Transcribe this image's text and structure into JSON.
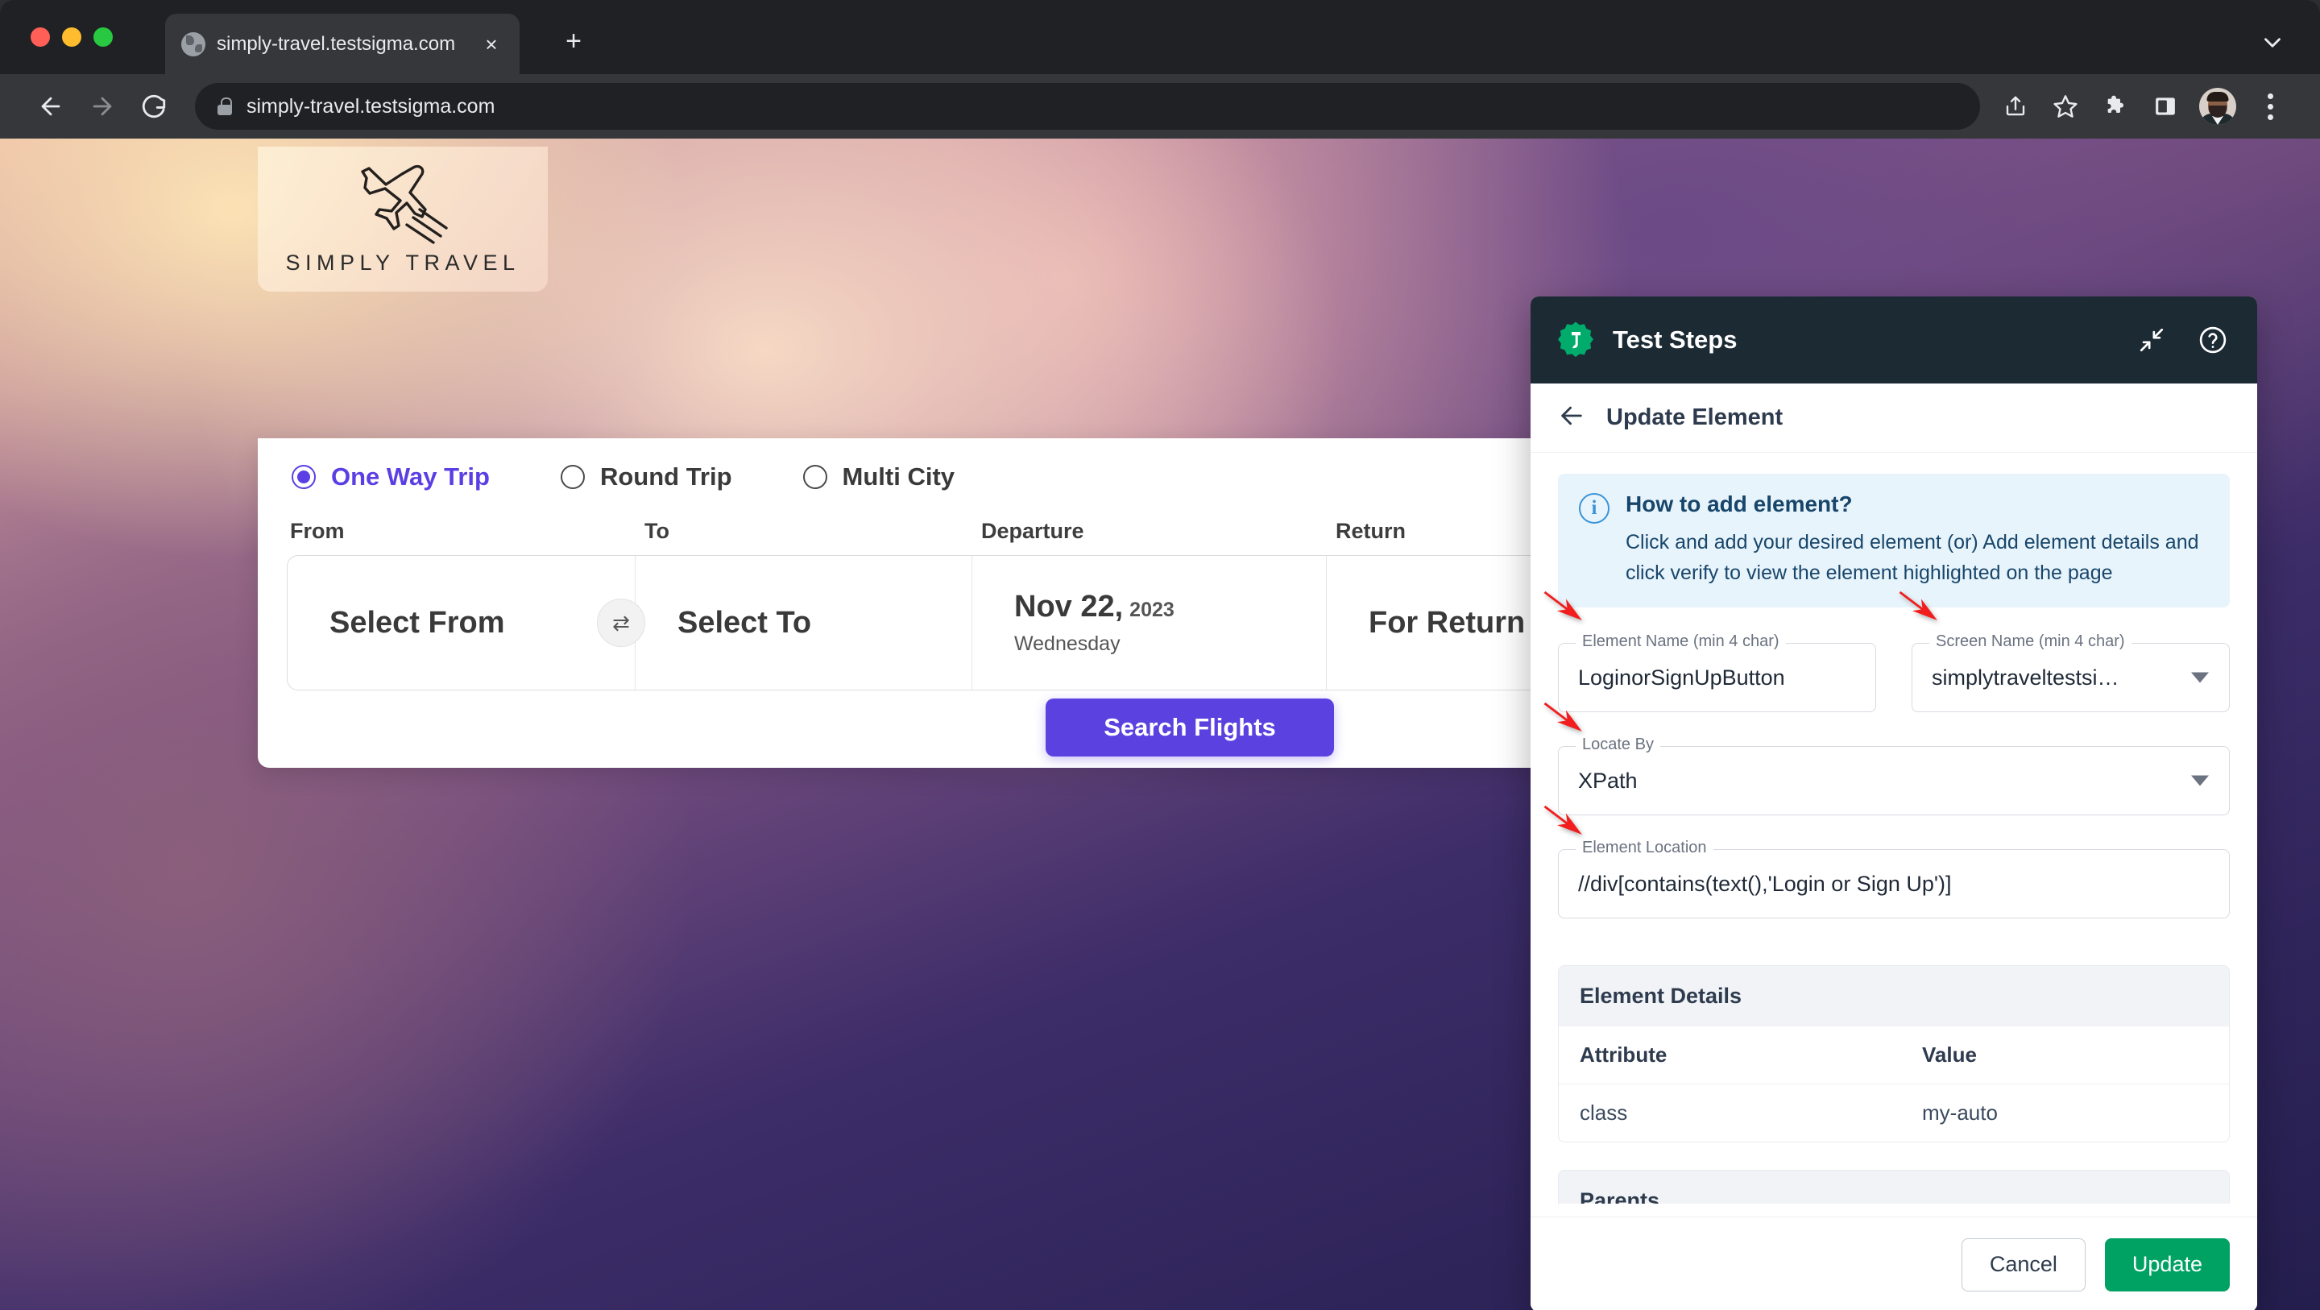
{
  "browser": {
    "tab": {
      "title": "simply-travel.testsigma.com",
      "favicon": "globe-icon",
      "close": "×"
    },
    "new_tab_label": "+",
    "address": {
      "url": "simply-travel.testsigma.com",
      "lock": "lock-icon"
    },
    "toolbar_icons": [
      "share-icon",
      "bookmark-star-icon",
      "extensions-puzzle-icon",
      "side-panel-icon",
      "profile-avatar",
      "more-menu-icon"
    ],
    "nav": {
      "back": "back-arrow-icon",
      "forward": "forward-arrow-icon",
      "reload": "reload-icon"
    }
  },
  "site": {
    "logo": {
      "text": "SIMPLY TRAVEL",
      "icon": "airplane-icon"
    },
    "trip_types": [
      {
        "label": "One Way Trip",
        "selected": true
      },
      {
        "label": "Round Trip",
        "selected": false
      },
      {
        "label": "Multi City",
        "selected": false
      }
    ],
    "field_headers": {
      "from": "From",
      "to": "To",
      "departure": "Departure",
      "return": "Return"
    },
    "fields": {
      "from": "Select From",
      "to": "Select To",
      "departure_date": "Nov 22,",
      "departure_year": "2023",
      "departure_day": "Wednesday",
      "return": "For Return"
    },
    "swap_icon": "⇄",
    "search_button": "Search Flights",
    "accent_purple": "#5b42e0"
  },
  "panel": {
    "title": "Test Steps",
    "logo_icon": "testsigma-logo-icon",
    "collapse_icon": "collapse-icon",
    "help_icon": "help-icon",
    "back_icon": "back-arrow-icon",
    "subtitle": "Update Element",
    "info": {
      "icon": "info-icon",
      "title": "How to add element?",
      "body": "Click and add your desired element (or) Add element details and click verify to view the element highlighted on the page"
    },
    "form": {
      "element_name": {
        "label": "Element Name (min 4 char)",
        "value": "LoginorSignUpButton"
      },
      "screen_name": {
        "label": "Screen Name (min 4 char)",
        "value": "simplytraveltestsi…"
      },
      "locate_by": {
        "label": "Locate By",
        "value": "XPath"
      },
      "element_location": {
        "label": "Element Location",
        "value": "//div[contains(text(),'Login or Sign Up')]"
      }
    },
    "details": {
      "title": "Element Details",
      "columns": {
        "attribute": "Attribute",
        "value": "Value"
      },
      "rows": [
        {
          "attribute": "class",
          "value": "my-auto"
        }
      ]
    },
    "parents_section_title": "Parents",
    "footer": {
      "cancel": "Cancel",
      "update": "Update",
      "update_color": "#00a263"
    }
  }
}
